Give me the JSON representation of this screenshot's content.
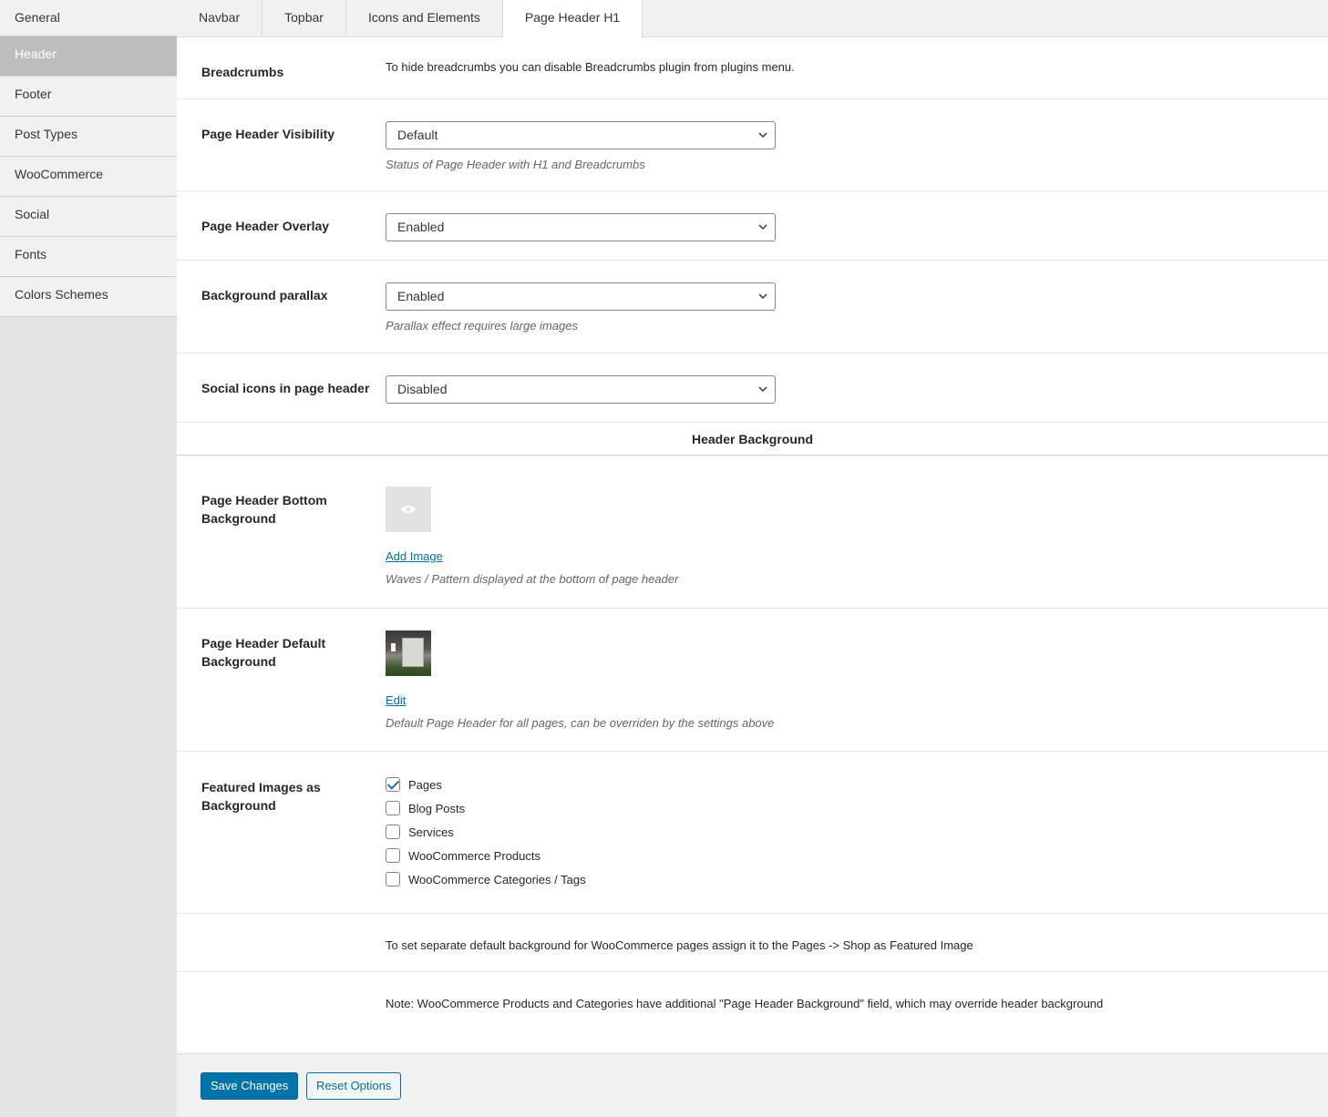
{
  "sidebar": {
    "items": [
      {
        "label": "General"
      },
      {
        "label": "Header"
      },
      {
        "label": "Footer"
      },
      {
        "label": "Post Types"
      },
      {
        "label": "WooCommerce"
      },
      {
        "label": "Social"
      },
      {
        "label": "Fonts"
      },
      {
        "label": "Colors Schemes"
      }
    ],
    "active": "Header"
  },
  "tabs": [
    {
      "label": "Navbar"
    },
    {
      "label": "Topbar"
    },
    {
      "label": "Icons and Elements"
    },
    {
      "label": "Page Header H1"
    }
  ],
  "active_tab": "Page Header H1",
  "rows": {
    "breadcrumbs": {
      "label": "Breadcrumbs",
      "text": "To hide breadcrumbs you can disable Breadcrumbs plugin from plugins menu."
    },
    "visibility": {
      "label": "Page Header Visibility",
      "value": "Default",
      "desc": "Status of Page Header with H1 and Breadcrumbs"
    },
    "overlay": {
      "label": "Page Header Overlay",
      "value": "Enabled"
    },
    "parallax": {
      "label": "Background parallax",
      "value": "Enabled",
      "desc": "Parallax effect requires large images"
    },
    "social": {
      "label": "Social icons in page header",
      "value": "Disabled"
    }
  },
  "section_title": "Header Background",
  "bottom_bg": {
    "label_line1": "Page Header Bottom",
    "label_line2": "Background",
    "link": "Add Image",
    "desc": "Waves / Pattern displayed at the bottom of page header"
  },
  "default_bg": {
    "label_line1": "Page Header Default",
    "label_line2": "Background",
    "link": "Edit",
    "desc": "Default Page Header for all pages, can be overriden by the settings above"
  },
  "featured": {
    "label_line1": "Featured Images as",
    "label_line2": "Background",
    "options": [
      {
        "label": "Pages",
        "checked": true
      },
      {
        "label": "Blog Posts",
        "checked": false
      },
      {
        "label": "Services",
        "checked": false
      },
      {
        "label": "WooCommerce Products",
        "checked": false
      },
      {
        "label": "WooCommerce Categories / Tags",
        "checked": false
      }
    ]
  },
  "notes": {
    "shop": "To set separate default background for WooCommerce pages assign it to the Pages -> Shop as Featured Image",
    "woo": "Note: WooCommerce Products and Categories have additional \"Page Header Background\" field, which may override header background"
  },
  "buttons": {
    "save": "Save Changes",
    "reset": "Reset Options"
  },
  "colors": {
    "accent": "#0073aa",
    "sidebar_active": "#bdbdbd"
  }
}
